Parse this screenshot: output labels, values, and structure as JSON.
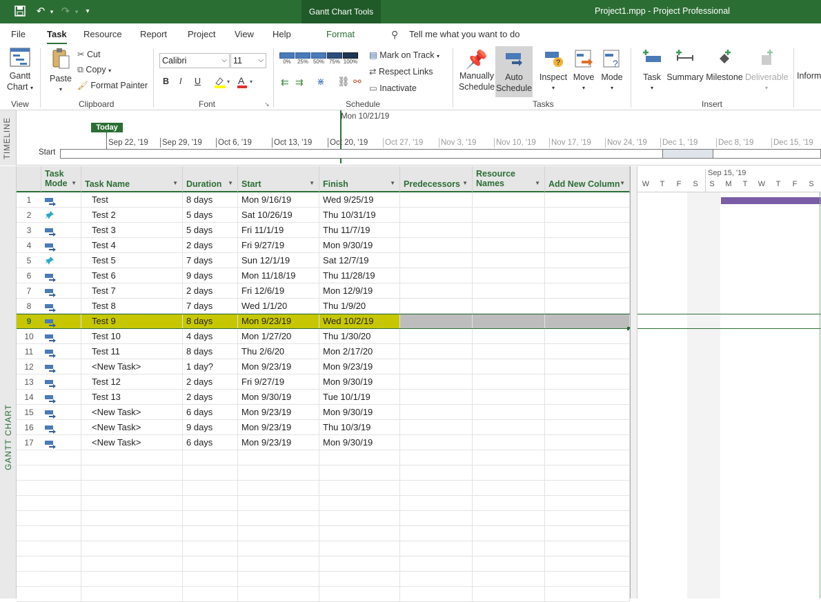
{
  "titlebar": {
    "context_tab": "Gantt Chart Tools",
    "title": "Project1.mpp  -  Project Professional"
  },
  "tabs": [
    "File",
    "Task",
    "Resource",
    "Report",
    "Project",
    "View",
    "Help",
    "Format"
  ],
  "tell_me": "Tell me what you want to do",
  "ribbon": {
    "view": {
      "gantt_label1": "Gantt",
      "gantt_label2": "Chart",
      "group": "View"
    },
    "clipboard": {
      "paste": "Paste",
      "cut": "Cut",
      "copy": "Copy",
      "format_painter": "Format Painter",
      "group": "Clipboard"
    },
    "font": {
      "family": "Calibri",
      "size": "11",
      "bold": "B",
      "italic": "I",
      "underline": "U",
      "group": "Font"
    },
    "schedule": {
      "pcts": [
        "0%",
        "25%",
        "50%",
        "75%",
        "100%"
      ],
      "mark_on_track": "Mark on Track",
      "respect_links": "Respect Links",
      "inactivate": "Inactivate",
      "group": "Schedule"
    },
    "tasks": {
      "manually1": "Manually",
      "manually2": "Schedule",
      "auto1": "Auto",
      "auto2": "Schedule",
      "inspect": "Inspect",
      "move": "Move",
      "mode": "Mode",
      "group": "Tasks"
    },
    "insert": {
      "task": "Task",
      "summary": "Summary",
      "milestone": "Milestone",
      "deliverable": "Deliverable",
      "group": "Insert"
    },
    "info": "Inform"
  },
  "timeline": {
    "side_label": "TIMELINE",
    "current_date": "Mon 10/21/19",
    "today": "Today",
    "start": "Start",
    "dates": [
      "Sep 22, '19",
      "Sep 29, '19",
      "Oct 6, '19",
      "Oct 13, '19",
      "Oct 20, '19",
      "Oct 27, '19",
      "Nov 3, '19",
      "Nov 10, '19",
      "Nov 17, '19",
      "Nov 24, '19",
      "Dec 1, '19",
      "Dec 8, '19",
      "Dec 15, '19"
    ]
  },
  "grid": {
    "side_label": "GANTT CHART",
    "headers": {
      "mode1": "Task",
      "mode2": "Mode",
      "name": "Task Name",
      "duration": "Duration",
      "start": "Start",
      "finish": "Finish",
      "pred": "Predecessors",
      "res1": "Resource",
      "res2": "Names",
      "add": "Add New Column"
    },
    "rows": [
      {
        "id": "1",
        "mode": "auto",
        "name": "Test",
        "duration": "8 days",
        "start": "Mon 9/16/19",
        "finish": "Wed 9/25/19"
      },
      {
        "id": "2",
        "mode": "manual",
        "name": "Test 2",
        "duration": "5 days",
        "start": "Sat 10/26/19",
        "finish": "Thu 10/31/19"
      },
      {
        "id": "3",
        "mode": "auto",
        "name": "Test 3",
        "duration": "5 days",
        "start": "Fri 11/1/19",
        "finish": "Thu 11/7/19"
      },
      {
        "id": "4",
        "mode": "auto",
        "name": "Test 4",
        "duration": "2 days",
        "start": "Fri 9/27/19",
        "finish": "Mon 9/30/19"
      },
      {
        "id": "5",
        "mode": "manual",
        "name": "Test 5",
        "duration": "7 days",
        "start": "Sun 12/1/19",
        "finish": "Sat 12/7/19"
      },
      {
        "id": "6",
        "mode": "auto",
        "name": "Test 6",
        "duration": "9 days",
        "start": "Mon 11/18/19",
        "finish": "Thu 11/28/19"
      },
      {
        "id": "7",
        "mode": "auto",
        "name": "Test 7",
        "duration": "2 days",
        "start": "Fri 12/6/19",
        "finish": "Mon 12/9/19"
      },
      {
        "id": "8",
        "mode": "auto",
        "name": "Test 8",
        "duration": "7 days",
        "start": "Wed 1/1/20",
        "finish": "Thu 1/9/20"
      },
      {
        "id": "9",
        "mode": "auto",
        "name": "Test 9",
        "duration": "8 days",
        "start": "Mon 9/23/19",
        "finish": "Wed 10/2/19"
      },
      {
        "id": "10",
        "mode": "auto",
        "name": "Test 10",
        "duration": "4 days",
        "start": "Mon 1/27/20",
        "finish": "Thu 1/30/20"
      },
      {
        "id": "11",
        "mode": "auto",
        "name": "Test 11",
        "duration": "8 days",
        "start": "Thu 2/6/20",
        "finish": "Mon 2/17/20"
      },
      {
        "id": "12",
        "mode": "auto",
        "name": "<New Task>",
        "duration": "1 day?",
        "start": "Mon 9/23/19",
        "finish": "Mon 9/23/19"
      },
      {
        "id": "13",
        "mode": "auto",
        "name": "Test 12",
        "duration": "2 days",
        "start": "Fri 9/27/19",
        "finish": "Mon 9/30/19"
      },
      {
        "id": "14",
        "mode": "auto",
        "name": "Test 13",
        "duration": "2 days",
        "start": "Mon 9/30/19",
        "finish": "Tue 10/1/19"
      },
      {
        "id": "15",
        "mode": "auto",
        "name": "<New Task>",
        "duration": "6 days",
        "start": "Mon 9/23/19",
        "finish": "Mon 9/30/19"
      },
      {
        "id": "16",
        "mode": "auto",
        "name": "<New Task>",
        "duration": "9 days",
        "start": "Mon 9/23/19",
        "finish": "Thu 10/3/19"
      },
      {
        "id": "17",
        "mode": "auto",
        "name": "<New Task>",
        "duration": "6 days",
        "start": "Mon 9/23/19",
        "finish": "Mon 9/30/19"
      }
    ]
  },
  "gantt": {
    "week": "Sep 15, '19",
    "days": [
      "W",
      "T",
      "F",
      "S",
      "S",
      "M",
      "T",
      "W",
      "T",
      "F",
      "S"
    ]
  },
  "colors": {
    "accent": "#2b6e34",
    "highlight": "#c7c700",
    "bar": "#7a5da6"
  }
}
